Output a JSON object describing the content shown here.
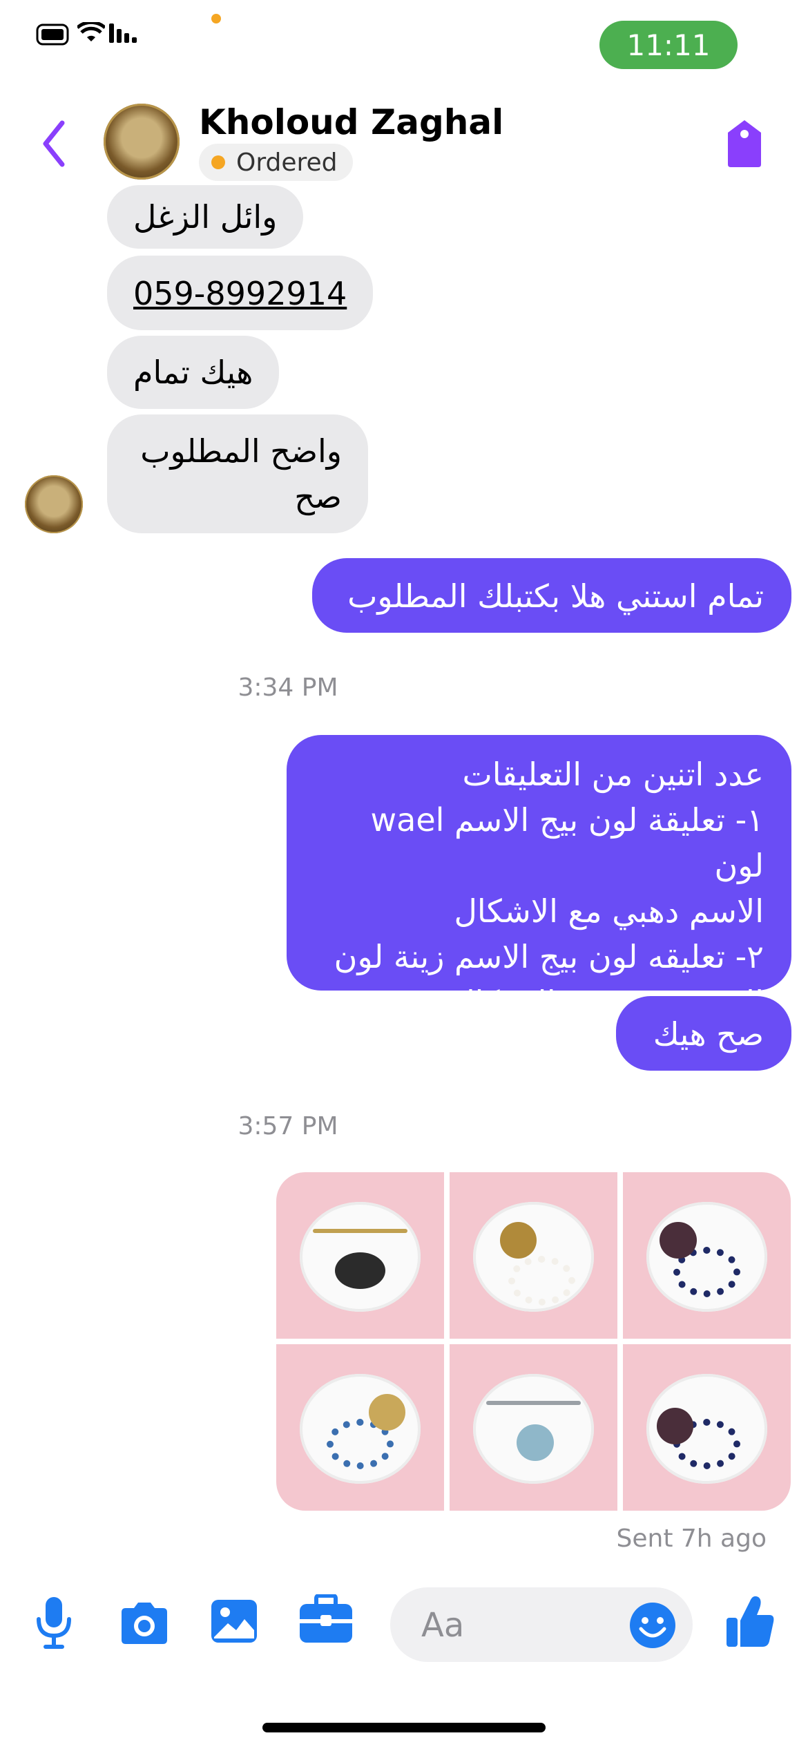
{
  "status_bar": {
    "time": "11:11"
  },
  "header": {
    "contact_name": "Kholoud Zaghal",
    "status_label": "Ordered"
  },
  "messages": {
    "in_1": "وائل الزغل",
    "in_2": "059-8992914",
    "in_3": "هيك تمام",
    "in_4_line1": "واضح المطلوب",
    "in_4_line2": "صح",
    "out_1": "تمام استني هلا بكتبلك المطلوب",
    "timestamp_1": "3:34 PM",
    "out_2_line1": "عدد اتنين من التعليقات",
    "out_2_line2": "١- تعليقة لون بيج الاسم wael لون",
    "out_2_line3": "الاسم دهبي مع الاشكال",
    "out_2_line4": "٢- تعليقه لون بيج الاسم زينة لون",
    "out_2_line5": "الاسم فضي مع الاشكال",
    "out_3": "صح هيك",
    "timestamp_2": "3:57 PM",
    "sent_status": "Sent 7h ago"
  },
  "composer": {
    "placeholder": "Aa"
  },
  "colors": {
    "accent": "#6a4df5",
    "icon_blue": "#1e7cf2",
    "incoming_bubble": "#e9e9eb",
    "status_pill": "#4caf50"
  }
}
